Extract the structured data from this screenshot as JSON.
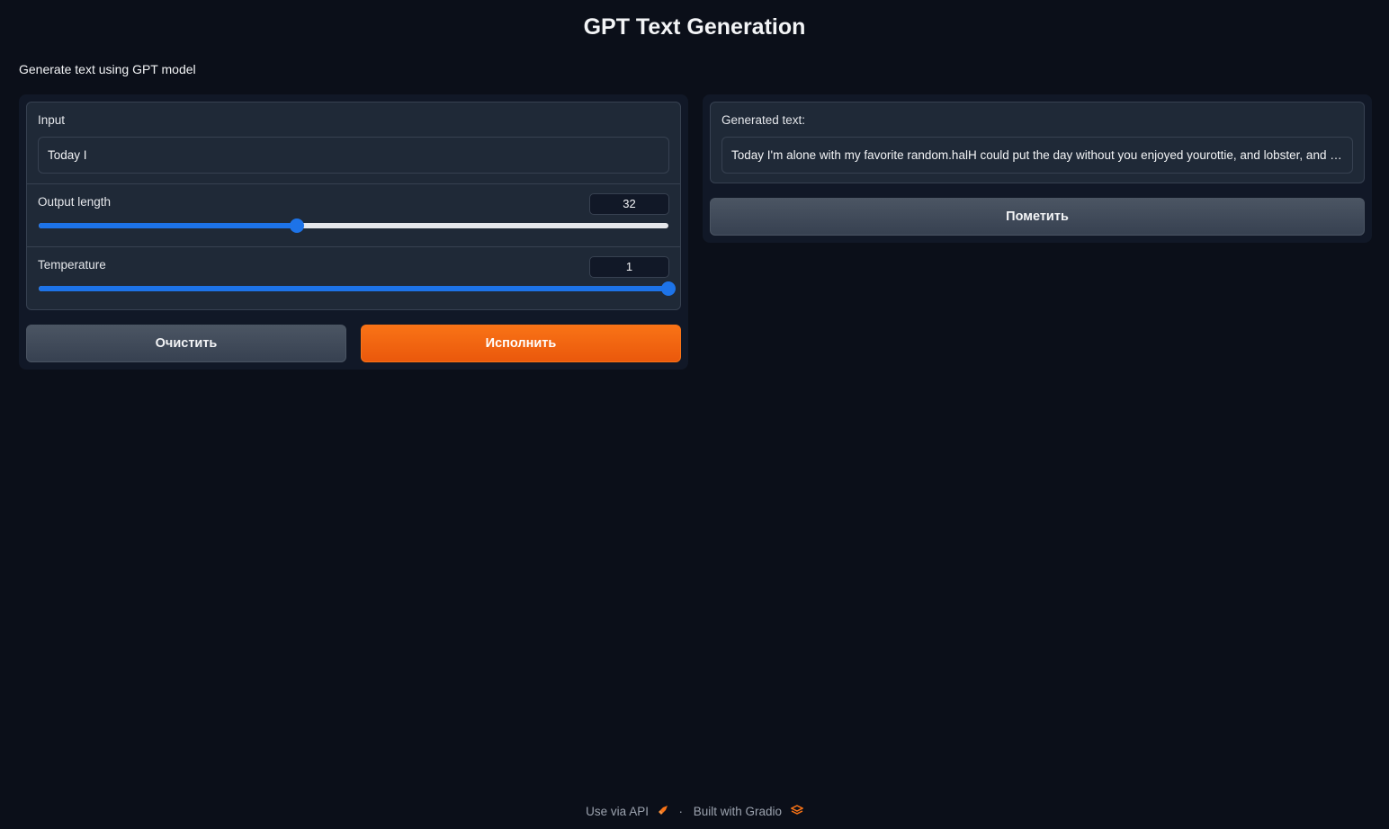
{
  "header": {
    "title": "GPT Text Generation",
    "description": "Generate text using GPT model"
  },
  "inputs": {
    "text": {
      "label": "Input",
      "value": "Today I"
    },
    "output_length": {
      "label": "Output length",
      "value": "32",
      "fraction": 0.41
    },
    "temperature": {
      "label": "Temperature",
      "value": "1",
      "fraction": 1.0
    }
  },
  "output": {
    "label": "Generated text:",
    "value": "Today I'm alone with my favorite random.halH could put the day without you enjoyed yourottie, and lobster, and I'm more happy than"
  },
  "buttons": {
    "clear": "Очистить",
    "submit": "Исполнить",
    "flag": "Пометить"
  },
  "footer": {
    "api": "Use via API",
    "separator": "·",
    "built": "Built with Gradio"
  },
  "colors": {
    "background": "#0b0f19",
    "accent": "#1d73e8",
    "primary": "#f97316"
  }
}
